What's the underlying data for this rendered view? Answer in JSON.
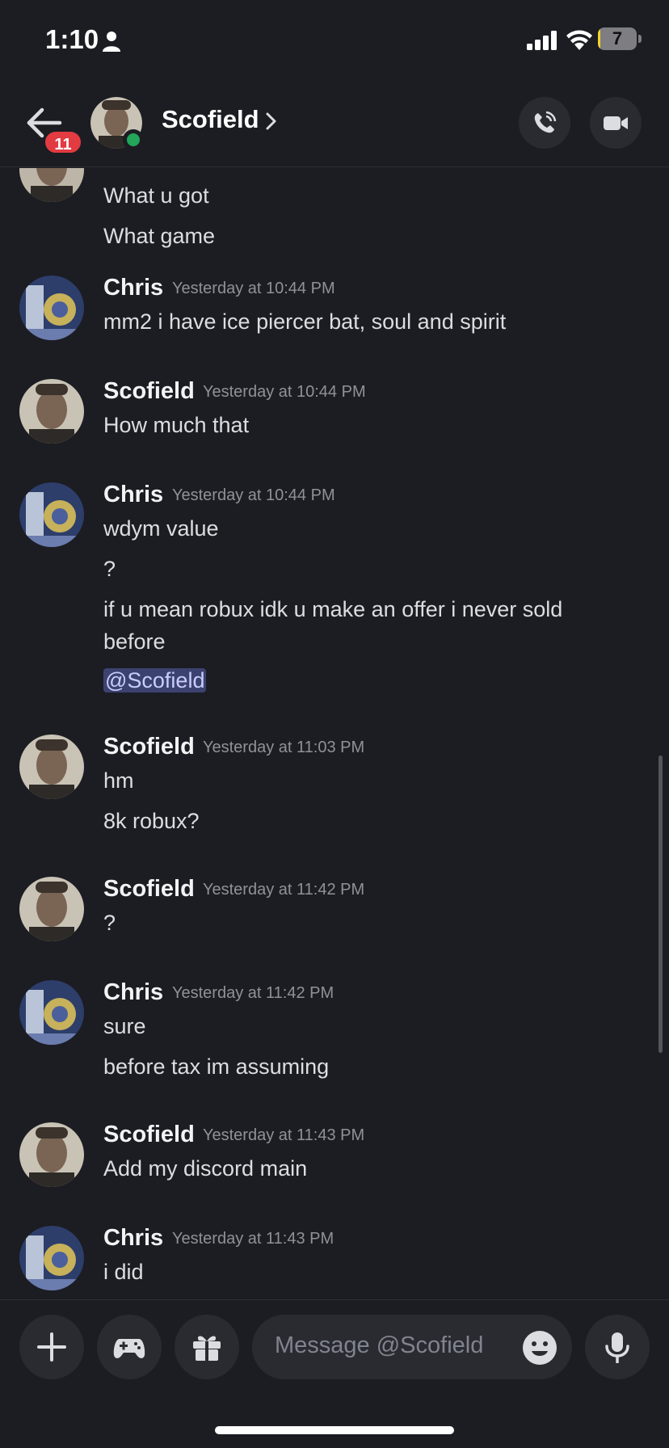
{
  "status_bar": {
    "time": "1:10",
    "battery_level": "7",
    "battery_fraction": 0.07
  },
  "header": {
    "back_badge": "11",
    "contact_name": "Scofield"
  },
  "messages": [
    {
      "lines": [
        "What u got",
        "What game"
      ]
    },
    {
      "author": "Chris",
      "timestamp": "Yesterday at 10:44 PM",
      "lines": [
        "mm2 i have ice piercer bat, soul and spirit"
      ]
    },
    {
      "author": "Scofield",
      "timestamp": "Yesterday at 10:44 PM",
      "lines": [
        "How much that"
      ]
    },
    {
      "author": "Chris",
      "timestamp": "Yesterday at 10:44 PM",
      "lines": [
        "wdym value",
        "?",
        "if u mean robux idk u make an offer i never sold before"
      ],
      "mention": "@Scofield"
    },
    {
      "author": "Scofield",
      "timestamp": "Yesterday at 11:03 PM",
      "lines": [
        "hm",
        "8k robux?"
      ]
    },
    {
      "author": "Scofield",
      "timestamp": "Yesterday at 11:42 PM",
      "lines": [
        "?"
      ]
    },
    {
      "author": "Chris",
      "timestamp": "Yesterday at 11:42 PM",
      "lines": [
        "sure",
        "before tax im assuming"
      ]
    },
    {
      "author": "Scofield",
      "timestamp": "Yesterday at 11:43 PM",
      "lines": [
        "Add my discord main"
      ]
    },
    {
      "author": "Chris",
      "timestamp": "Yesterday at 11:43 PM",
      "lines": [
        "i did"
      ]
    }
  ],
  "composer": {
    "placeholder": "Message @Scofield"
  },
  "colors": {
    "background": "#1c1d22",
    "online": "#23a55a",
    "badge": "#e23b41",
    "mention_bg": "#3c4270"
  }
}
